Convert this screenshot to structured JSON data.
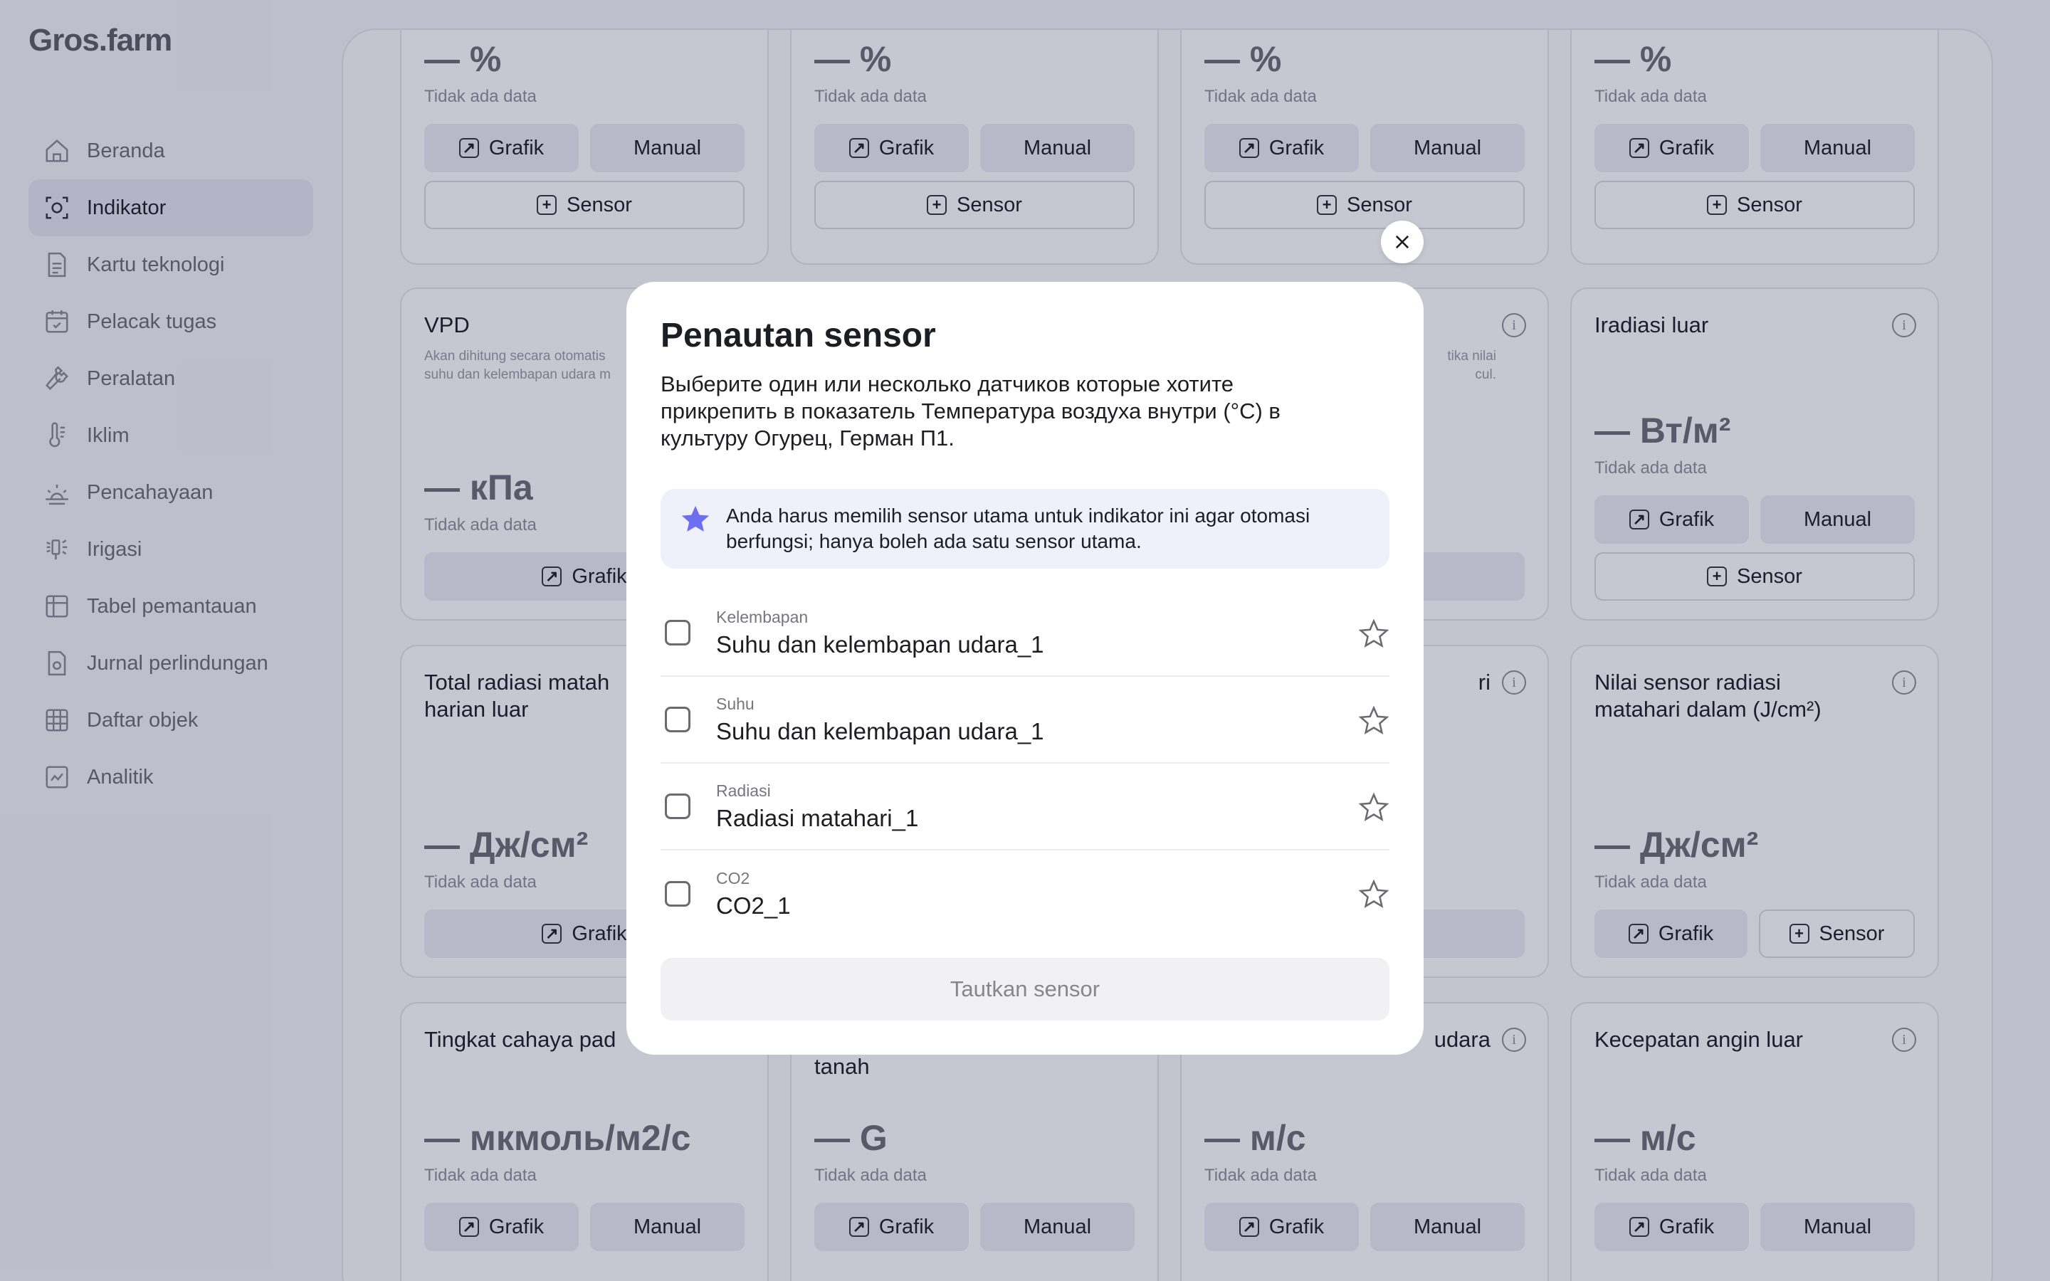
{
  "brand": "Gros.farm",
  "sidebar": {
    "items": [
      {
        "label": "Beranda",
        "icon": "home-icon"
      },
      {
        "label": "Indikator",
        "icon": "target-icon",
        "active": true
      },
      {
        "label": "Kartu teknologi",
        "icon": "document-icon"
      },
      {
        "label": "Pelacak tugas",
        "icon": "calendar-check-icon"
      },
      {
        "label": "Peralatan",
        "icon": "wrench-icon"
      },
      {
        "label": "Iklim",
        "icon": "thermometer-icon"
      },
      {
        "label": "Pencahayaan",
        "icon": "sunrise-icon"
      },
      {
        "label": "Irigasi",
        "icon": "sprinkler-icon"
      },
      {
        "label": "Tabel pemantauan",
        "icon": "table-icon"
      },
      {
        "label": "Jurnal perlindungan",
        "icon": "shield-doc-icon"
      },
      {
        "label": "Daftar objek",
        "icon": "grid-icon"
      },
      {
        "label": "Analitik",
        "icon": "chart-icon"
      }
    ]
  },
  "common": {
    "no_data": "Tidak ada data",
    "grafik": "Grafik",
    "manual": "Manual",
    "sensor": "Sensor"
  },
  "cards": {
    "r1": {
      "value": "— %"
    },
    "vpd": {
      "title": "VPD",
      "desc": "Akan dihitung secara otomatis",
      "desc2": "suhu dan kelembapan udara m",
      "value": "— кПа"
    },
    "c23": {
      "desc": "tika nilai",
      "desc2": "cul."
    },
    "irr": {
      "title": "Iradiasi luar",
      "value": "— Вт/м²"
    },
    "tot": {
      "title": "Total radiasi matah",
      "title2": "harian luar",
      "value": "— Дж/см²"
    },
    "c33": {
      "title": "ri"
    },
    "sens": {
      "title": "Nilai sensor radiasi",
      "title2": "matahari dalam (J/cm²)",
      "value": "— Дж/см²"
    },
    "light": {
      "title": "Tingkat cahaya pad",
      "value": "— мкмоль/м2/с"
    },
    "c42": {
      "title": "tanah",
      "value": "— G"
    },
    "c43": {
      "title": "udara",
      "value": "— м/с"
    },
    "wind": {
      "title": "Kecepatan angin luar",
      "value": "— м/с"
    }
  },
  "modal": {
    "title": "Penautan sensor",
    "description": "Выберите один или несколько датчиков которые хотите прикрепить в показатель  Температура воздуха внутри (°C) в культуру Огурец, Герман П1.",
    "notice": "Anda harus memilih sensor utama untuk indikator ini agar otomasi berfungsi; hanya boleh ada satu sensor utama.",
    "sensors": [
      {
        "type": "Kelembapan",
        "name": "Suhu dan kelembapan udara_1"
      },
      {
        "type": "Suhu",
        "name": "Suhu dan kelembapan udara_1"
      },
      {
        "type": "Radiasi",
        "name": "Radiasi matahari_1"
      },
      {
        "type": "CO2",
        "name": "CO2_1"
      }
    ],
    "link_button": "Tautkan sensor"
  },
  "colors": {
    "accent": "#6e6ef0",
    "overlay": "rgba(30,30,70,0.25)"
  }
}
